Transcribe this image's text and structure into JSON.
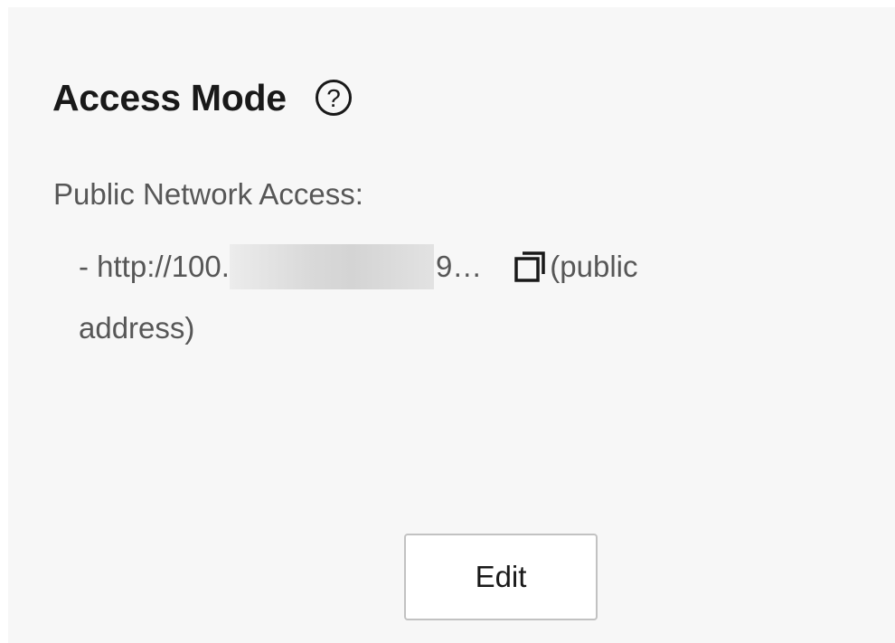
{
  "section": {
    "title": "Access Mode",
    "help_icon": "question-circle-icon"
  },
  "access": {
    "label": "Public Network Access:",
    "url_prefix": "- http://100.",
    "url_suffix": "9…",
    "copy_icon": "copy-icon",
    "note_part1": "(public",
    "note_part2": "address)"
  },
  "actions": {
    "edit_label": "Edit"
  }
}
